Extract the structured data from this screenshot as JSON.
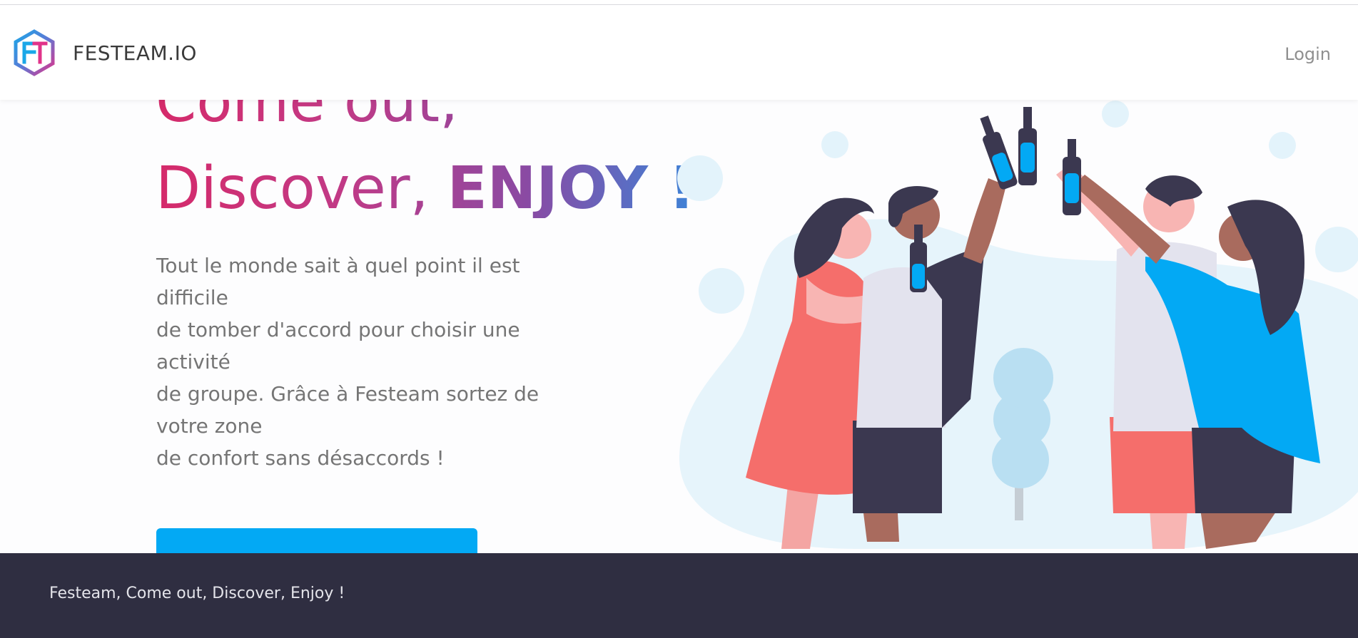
{
  "brand": {
    "name": "FESTEAM.IO",
    "logo_letters": "FT",
    "logo_icon": "hexagon-ft-logo"
  },
  "nav": {
    "login_label": "Login"
  },
  "hero": {
    "headline_line1": "Come out,",
    "headline_line2_prefix": "Discover, ",
    "headline_line2_emphasis": "ENJOY !",
    "description_lines": [
      "Tout le monde sait à quel point il est",
      "difficile",
      "de tomber d'accord pour choisir une",
      "activité",
      "de groupe. Grâce à Festeam sortez de",
      "votre zone",
      "de confort sans désaccords !"
    ],
    "cta_label": "",
    "illustration": "friends-toasting-bottles-illustration"
  },
  "footer": {
    "text": "Festeam, Come out, Discover, Enjoy !"
  },
  "colors": {
    "accent": "#03a9f4",
    "gradient_start": "#d52a6a",
    "gradient_end": "#1a9be2",
    "footer_bg": "#2f2e41",
    "text_muted": "#757575"
  }
}
